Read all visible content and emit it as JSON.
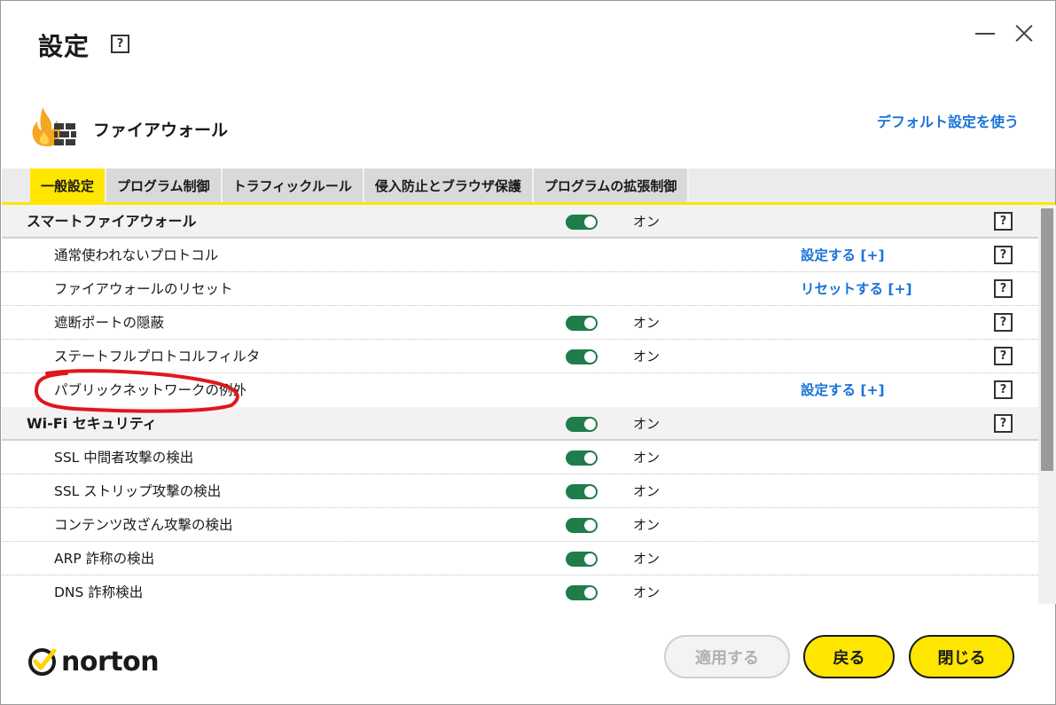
{
  "window": {
    "title": "設定"
  },
  "section": {
    "title": "ファイアウォール",
    "default_link": "デフォルト設定を使う"
  },
  "tabs": [
    {
      "label": "一般設定",
      "active": true
    },
    {
      "label": "プログラム制御",
      "active": false
    },
    {
      "label": "トラフィックルール",
      "active": false
    },
    {
      "label": "侵入防止とブラウザ保護",
      "active": false
    },
    {
      "label": "プログラムの拡張制御",
      "active": false
    }
  ],
  "rows": [
    {
      "type": "section",
      "label": "スマートファイアウォール",
      "toggle": true,
      "state": "オン",
      "help": "?"
    },
    {
      "type": "item",
      "label": "通常使われないプロトコル",
      "action": "設定する [+]",
      "help": "?"
    },
    {
      "type": "item",
      "label": "ファイアウォールのリセット",
      "action": "リセットする [+]",
      "help": "?"
    },
    {
      "type": "item",
      "label": "遮断ポートの隠蔽",
      "toggle": true,
      "state": "オン",
      "help": "?"
    },
    {
      "type": "item",
      "label": "ステートフルプロトコルフィルタ",
      "toggle": true,
      "state": "オン",
      "help": "?"
    },
    {
      "type": "item",
      "label": "パブリックネットワークの例外",
      "action": "設定する [+]",
      "help": "?"
    },
    {
      "type": "section",
      "label": "Wi-Fi セキュリティ",
      "toggle": true,
      "state": "オン",
      "help": "?"
    },
    {
      "type": "item",
      "label": "SSL 中間者攻撃の検出",
      "toggle": true,
      "state": "オン"
    },
    {
      "type": "item",
      "label": "SSL ストリップ攻撃の検出",
      "toggle": true,
      "state": "オン"
    },
    {
      "type": "item",
      "label": "コンテンツ改ざん攻撃の検出",
      "toggle": true,
      "state": "オン"
    },
    {
      "type": "item",
      "label": "ARP 詐称の検出",
      "toggle": true,
      "state": "オン"
    },
    {
      "type": "item",
      "label": "DNS 詐称検出",
      "toggle": true,
      "state": "オン"
    }
  ],
  "help_glyph": "?",
  "brand": {
    "name": "norton"
  },
  "buttons": {
    "apply": "適用する",
    "back": "戻る",
    "close": "閉じる"
  },
  "colors": {
    "accent": "#ffe600",
    "toggle_on": "#1e7d4a",
    "link": "#1a73d9",
    "flame": "#f5a623"
  },
  "icons": [
    "help-icon",
    "minimize-icon",
    "close-icon",
    "firewall-icon",
    "norton-check-icon"
  ]
}
